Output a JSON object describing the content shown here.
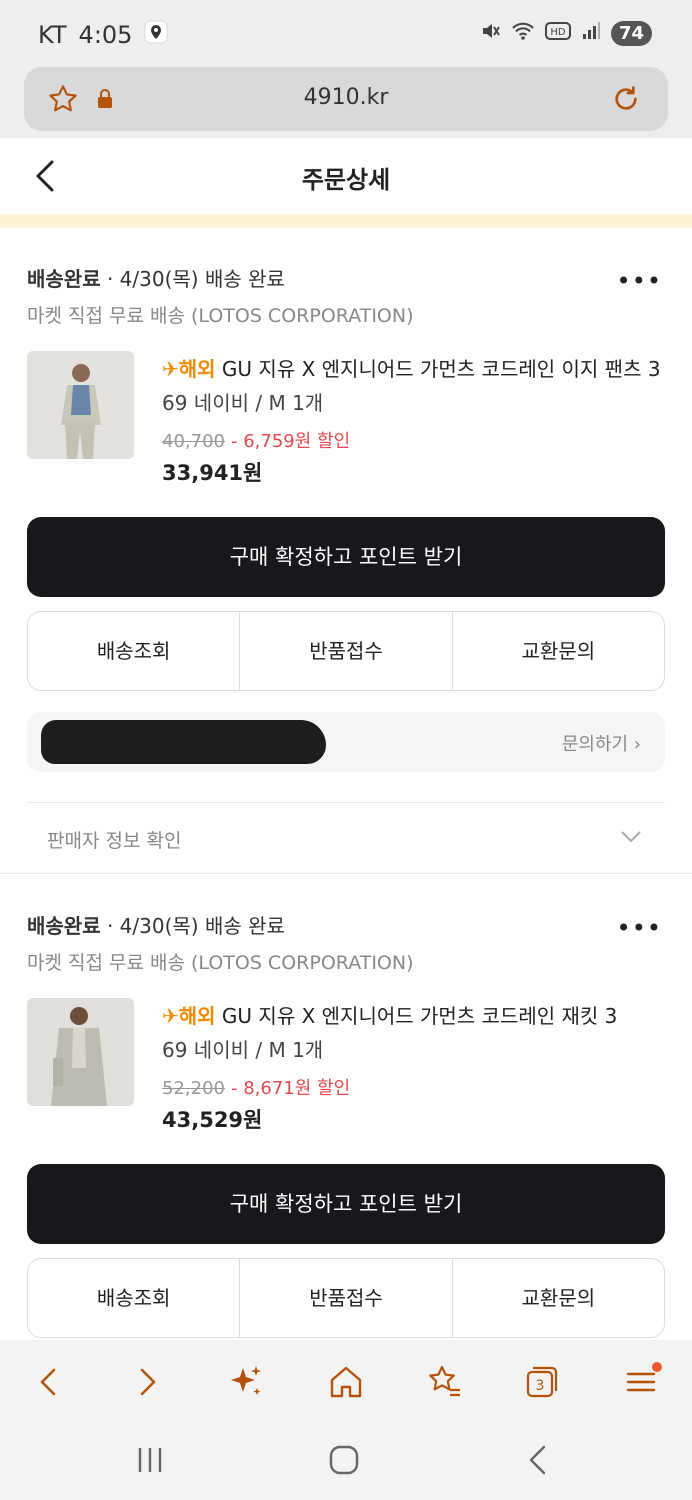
{
  "status_bar": {
    "carrier": "KT",
    "time": "4:05",
    "battery": "74"
  },
  "browser": {
    "url": "4910.kr",
    "tab_count": "3"
  },
  "header": {
    "title": "주문상세"
  },
  "orders": [
    {
      "status": "배송완료",
      "status_detail": " · 4/30(목) 배송 완료",
      "shipping": "마켓 직접 무료 배송 (LOTOS CORPORATION)",
      "tag": "해외",
      "product_name": " GU 지유 X 엔지니어드 가먼츠 코드레인 이지 팬츠 3",
      "option": "69 네이비 / M  1개",
      "original_price": "40,700",
      "discount": "- 6,759원 할인",
      "final_price": "33,941원",
      "confirm_label": "구매 확정하고 포인트 받기",
      "actions": [
        "배송조회",
        "반품접수",
        "교환문의"
      ],
      "inquiry_link": "문의하기 ›",
      "seller_info": "판매자 정보 확인"
    },
    {
      "status": "배송완료",
      "status_detail": " · 4/30(목) 배송 완료",
      "shipping": "마켓 직접 무료 배송 (LOTOS CORPORATION)",
      "tag": "해외",
      "product_name": " GU 지유 X 엔지니어드 가먼츠 코드레인 재킷 3",
      "option": "69 네이비 / M  1개",
      "original_price": "52,200",
      "discount": "- 8,671원 할인",
      "final_price": "43,529원",
      "confirm_label": "구매 확정하고 포인트 받기",
      "actions": [
        "배송조회",
        "반품접수",
        "교환문의"
      ]
    }
  ],
  "colors": {
    "accent": "#b45309",
    "overseas_tag": "#f08a00",
    "discount": "#e5484d",
    "confirm_button": "#16181c"
  }
}
